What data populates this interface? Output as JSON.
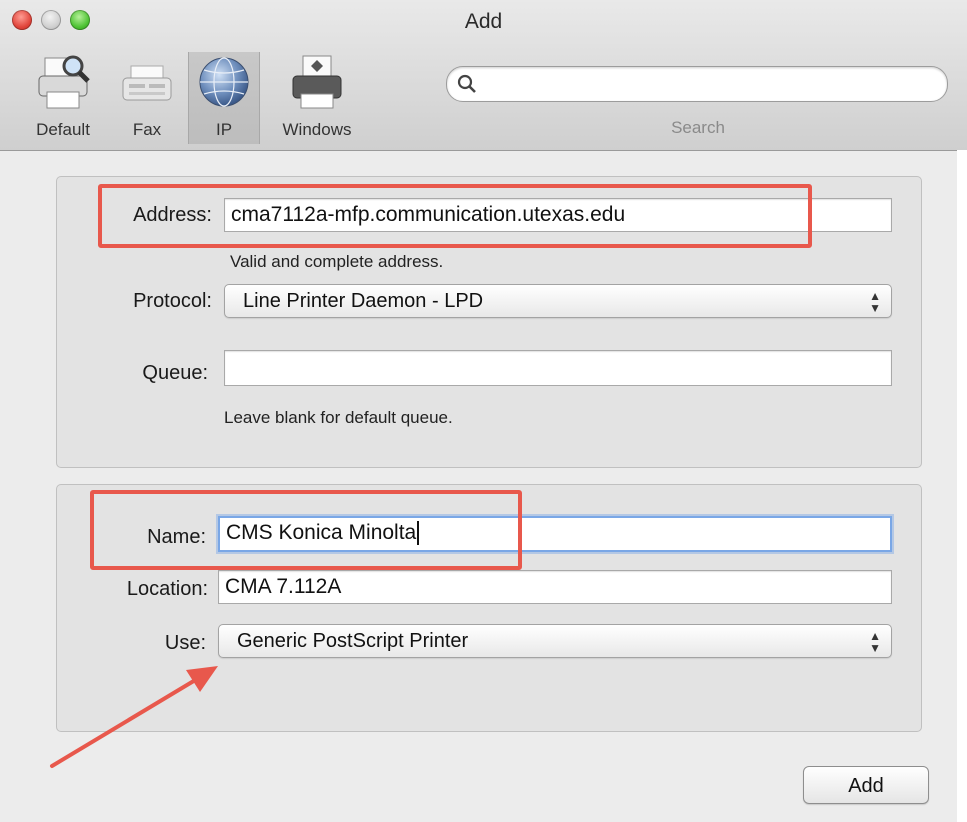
{
  "window": {
    "title": "Add"
  },
  "toolbar": {
    "items": [
      {
        "label": "Default",
        "icon": "printer-magnifier-icon"
      },
      {
        "label": "Fax",
        "icon": "fax-icon"
      },
      {
        "label": "IP",
        "icon": "globe-icon",
        "selected": true
      },
      {
        "label": "Windows",
        "icon": "windows-printer-icon"
      }
    ],
    "search_placeholder": "",
    "search_label": "Search"
  },
  "connection": {
    "address_label": "Address:",
    "address_value": "cma7112a-mfp.communication.utexas.edu",
    "address_hint": "Valid and complete address.",
    "protocol_label": "Protocol:",
    "protocol_value": "Line Printer Daemon - LPD",
    "queue_label": "Queue:",
    "queue_value": "",
    "queue_hint": "Leave blank for default queue."
  },
  "details": {
    "name_label": "Name:",
    "name_value": "CMS Konica Minolta",
    "location_label": "Location:",
    "location_value": "CMA 7.112A",
    "use_label": "Use:",
    "use_value": "Generic PostScript Printer"
  },
  "actions": {
    "add_label": "Add"
  },
  "colors": {
    "highlight": "#e8584c",
    "focus_ring": "#7aa7e6",
    "window_bg": "#ececec"
  }
}
